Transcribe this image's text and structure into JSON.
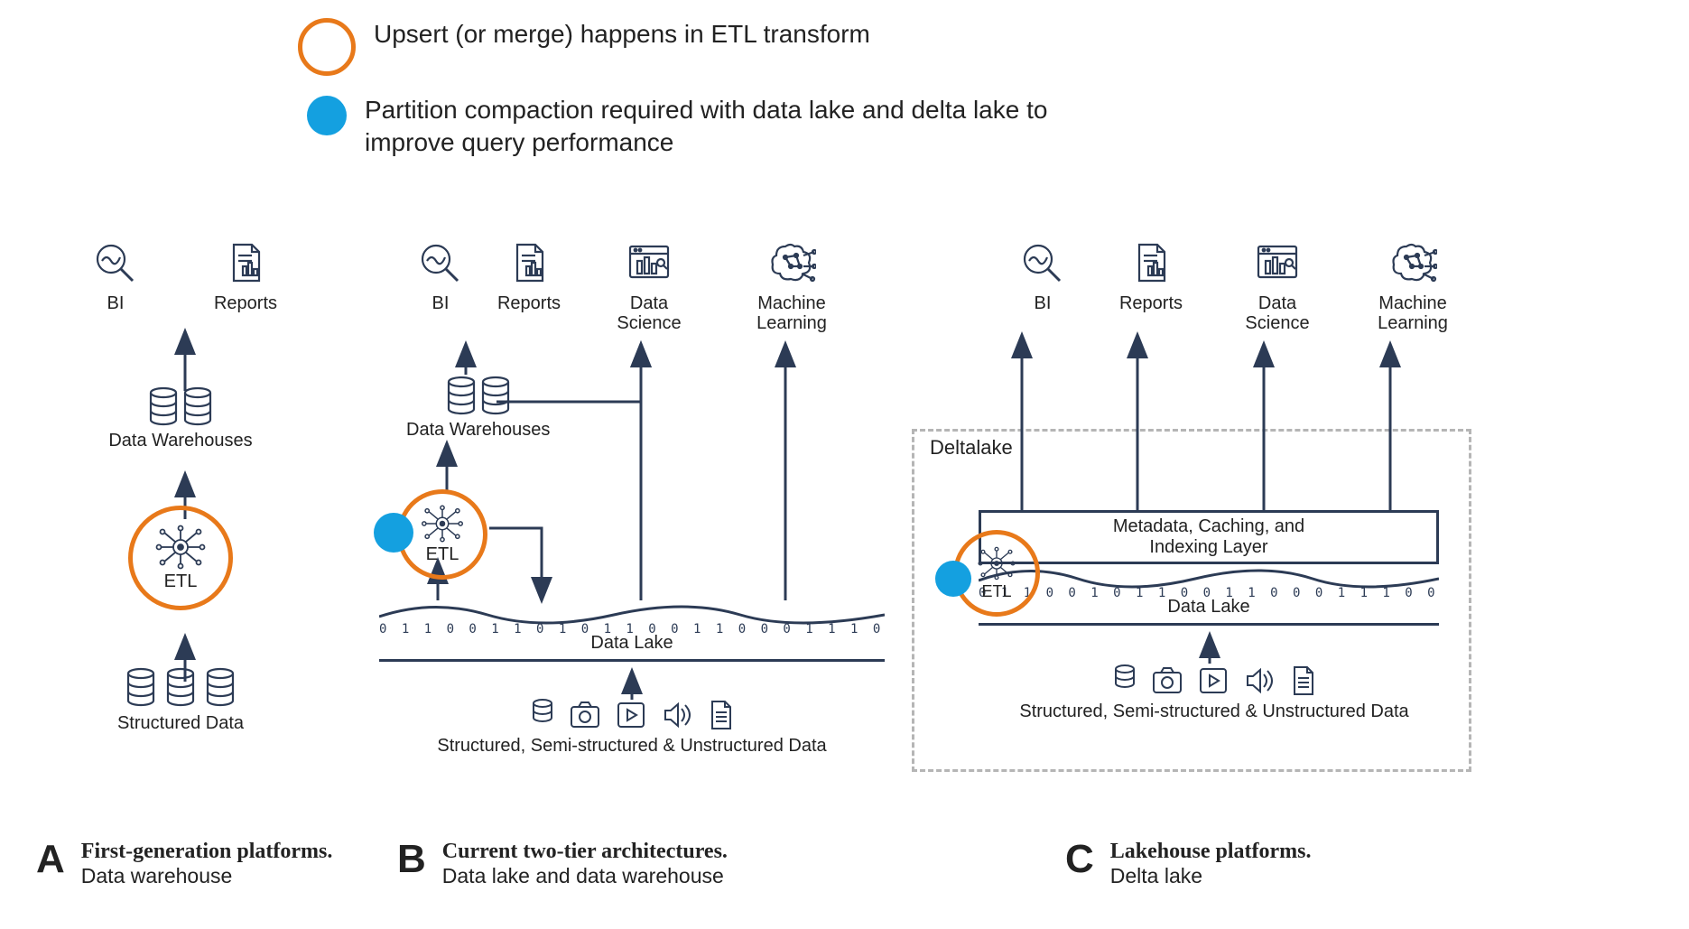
{
  "legend": {
    "upsert": "Upsert (or merge) happens in ETL transform",
    "compaction": "Partition compaction required with data lake and delta lake to improve query performance"
  },
  "apps": {
    "bi": "BI",
    "reports": "Reports",
    "data_science": "Data\nScience",
    "ml": "Machine\nLearning"
  },
  "labels": {
    "data_warehouses": "Data Warehouses",
    "etl": "ETL",
    "structured": "Structured Data",
    "data_lake": "Data Lake",
    "mixed_sources": "Structured, Semi-structured & Unstructured Data",
    "deltalake": "Deltalake",
    "metadata_layer": "Metadata, Caching, and\nIndexing Layer"
  },
  "captions": {
    "a_letter": "A",
    "a_title": "First-generation platforms.",
    "a_sub": "Data warehouse",
    "b_letter": "B",
    "b_title": "Current two-tier architectures.",
    "b_sub": "Data lake and data warehouse",
    "c_letter": "C",
    "c_title": "Lakehouse platforms.",
    "c_sub": "Delta lake"
  }
}
